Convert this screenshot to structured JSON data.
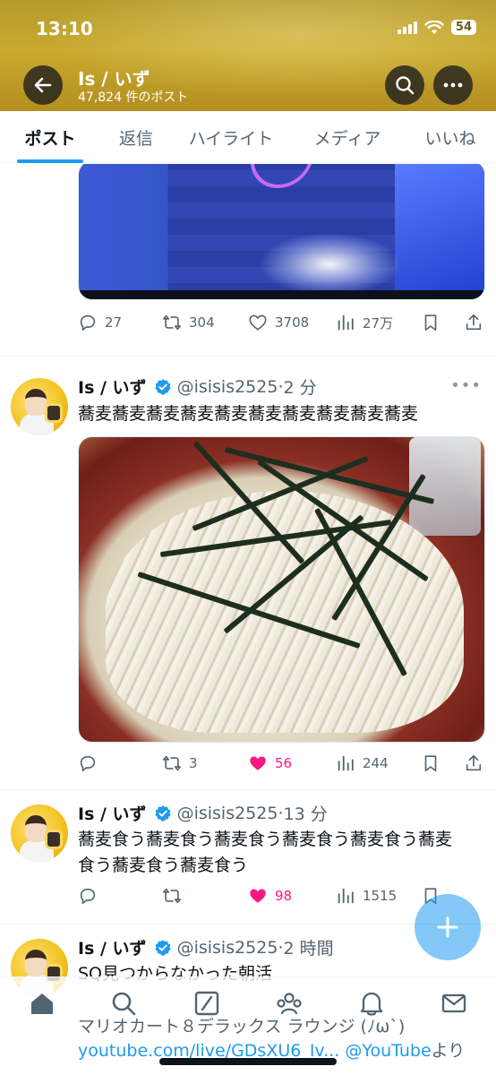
{
  "status_bar": {
    "time": "13:10",
    "battery": "54"
  },
  "header": {
    "name": "Is / いず",
    "post_count": "47,824 件のポスト"
  },
  "tabs": [
    {
      "label": "ポスト",
      "active": true
    },
    {
      "label": "返信",
      "active": false
    },
    {
      "label": "ハイライト",
      "active": false
    },
    {
      "label": "メディア",
      "active": false
    },
    {
      "label": "いいね",
      "active": false
    }
  ],
  "tweets": [
    {
      "actions": {
        "replies": "27",
        "reposts": "304",
        "likes": "3708",
        "views": "27万",
        "liked": false
      }
    },
    {
      "name": "Is / いず",
      "handle": "@isisis2525",
      "time": "2 分",
      "text": "蕎麦蕎麦蕎麦蕎麦蕎麦蕎麦蕎麦蕎麦蕎麦蕎麦",
      "actions": {
        "replies": "",
        "reposts": "3",
        "likes": "56",
        "views": "244",
        "liked": true
      }
    },
    {
      "name": "Is / いず",
      "handle": "@isisis2525",
      "time": "13 分",
      "text_line1": "蕎麦食う蕎麦食う蕎麦食う蕎麦食う蕎麦食う蕎麦",
      "text_line2": "食う蕎麦食う蕎麦食う",
      "actions": {
        "replies": "",
        "reposts": "",
        "likes": "98",
        "views": "1515",
        "liked": true
      }
    },
    {
      "name": "Is / いず",
      "handle": "@isisis2525",
      "time": "2 時間",
      "text": "SQ見つからなかった朝活",
      "link_title": "マリオカート８デラックス ラウンジ (ﾉω`)",
      "link_url": "youtube.com/live/GDsXU6_Iv...",
      "link_via": "@YouTube",
      "link_suffix": "より"
    }
  ],
  "colors": {
    "accent": "#1d9bf0",
    "like": "#f91880",
    "text": "#0f1419",
    "muted": "#536471"
  },
  "icons": {
    "header": [
      "back-arrow-icon",
      "search-icon",
      "more-icon"
    ],
    "nav": [
      "home-icon",
      "search-icon",
      "grok-icon",
      "communities-icon",
      "notifications-icon",
      "messages-icon"
    ],
    "fab": "plus-icon"
  }
}
